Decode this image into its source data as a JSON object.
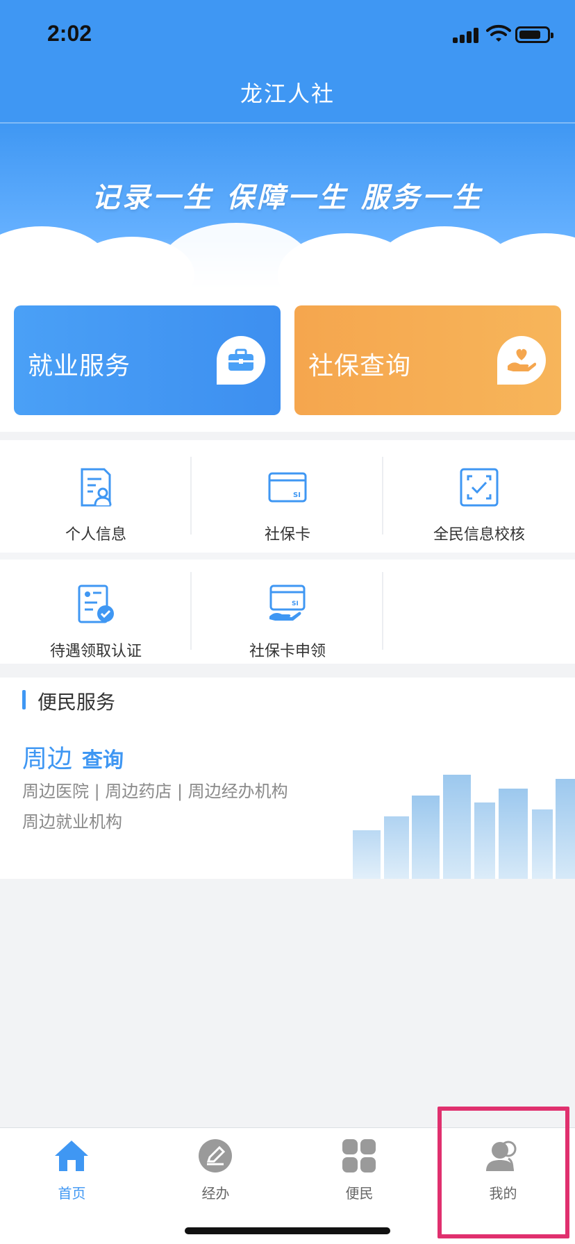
{
  "status_bar": {
    "time": "2:02"
  },
  "header": {
    "title": "龙江人社"
  },
  "banner": {
    "slogan": "记录一生 保障一生 服务一生"
  },
  "service_cards": [
    {
      "label": "就业服务",
      "icon": "briefcase-icon",
      "color": "#4aa0f6"
    },
    {
      "label": "社保查询",
      "icon": "heart-hand-icon",
      "color": "#f5a64e"
    }
  ],
  "grid": {
    "items": [
      {
        "label": "个人信息",
        "icon": "personal-info-icon"
      },
      {
        "label": "社保卡",
        "icon": "si-card-icon"
      },
      {
        "label": "全民信息校核",
        "icon": "verify-scan-icon"
      },
      {
        "label": "待遇领取认证",
        "icon": "certification-icon"
      },
      {
        "label": "社保卡申领",
        "icon": "si-card-apply-icon"
      }
    ]
  },
  "convenience": {
    "section_title": "便民服务",
    "heading_main": "周边",
    "heading_sub": "查询",
    "line1": "周边医院 | 周边药店 | 周边经办机构",
    "line2": "周边就业机构"
  },
  "tabbar": {
    "tabs": [
      {
        "label": "首页",
        "icon": "home-icon",
        "active": true
      },
      {
        "label": "经办",
        "icon": "edit-icon",
        "active": false
      },
      {
        "label": "便民",
        "icon": "grid-apps-icon",
        "active": false
      },
      {
        "label": "我的",
        "icon": "user-icon",
        "active": false
      }
    ]
  },
  "colors": {
    "primary": "#3f97f3",
    "orange": "#f5a64e",
    "highlight": "#e0306e"
  }
}
